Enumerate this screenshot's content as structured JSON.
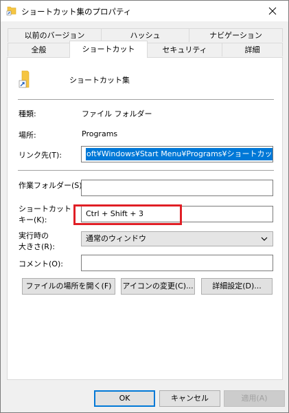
{
  "window": {
    "title": "ショートカット集のプロパティ"
  },
  "tabs": {
    "row1": [
      {
        "label": "以前のバージョン"
      },
      {
        "label": "ハッシュ"
      },
      {
        "label": "ナビゲーション"
      }
    ],
    "row2": [
      {
        "label": "全般"
      },
      {
        "label": "ショートカット"
      },
      {
        "label": "セキュリティ"
      },
      {
        "label": "詳細"
      }
    ],
    "active": "ショートカット"
  },
  "shortcut": {
    "name": "ショートカット集",
    "type_label": "種類:",
    "type_value": "ファイル フォルダー",
    "location_label": "場所:",
    "location_value": "Programs",
    "target_label": "リンク先(T):",
    "target_value": "oft¥Windows¥Start Menu¥Programs¥ショートカット集\"",
    "workdir_label": "作業フォルダー(S):",
    "workdir_value": "",
    "hotkey_label_line1": "ショートカット",
    "hotkey_label_line2": "キー(K):",
    "hotkey_value": "Ctrl + Shift + 3",
    "run_label_line1": "実行時の",
    "run_label_line2": "大きさ(R):",
    "run_value": "通常のウィンドウ",
    "comment_label": "コメント(O):",
    "comment_value": ""
  },
  "buttons": {
    "open_location": "ファイルの場所を開く(F)",
    "change_icon": "アイコンの変更(C)...",
    "advanced": "詳細設定(D)...",
    "ok": "OK",
    "cancel": "キャンセル",
    "apply": "適用(A)"
  },
  "colors": {
    "highlight_border": "#e01e25",
    "selection": "#0078d7",
    "folder": "#f5c542"
  },
  "icons": {
    "title": "folder-shortcut-icon",
    "close": "close-icon",
    "file": "folder-shortcut-icon",
    "dropdown": "chevron-down-icon"
  }
}
